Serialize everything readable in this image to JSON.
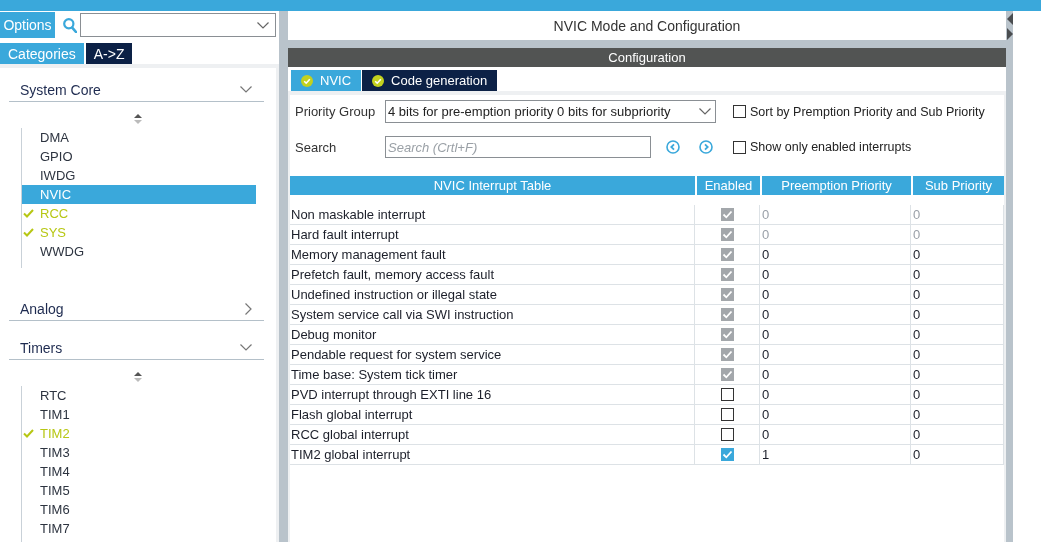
{
  "sidebar": {
    "options_label": "Options",
    "view_tabs": [
      {
        "label": "Categories",
        "selected": true
      },
      {
        "label": "A->Z",
        "selected": false
      }
    ],
    "sections": [
      {
        "title": "System Core",
        "expanded": true,
        "items": [
          {
            "label": "DMA",
            "selected": false,
            "configured": false
          },
          {
            "label": "GPIO",
            "selected": false,
            "configured": false
          },
          {
            "label": "IWDG",
            "selected": false,
            "configured": false
          },
          {
            "label": "NVIC",
            "selected": true,
            "configured": false
          },
          {
            "label": "RCC",
            "selected": false,
            "configured": true
          },
          {
            "label": "SYS",
            "selected": false,
            "configured": true
          },
          {
            "label": "WWDG",
            "selected": false,
            "configured": false
          }
        ]
      },
      {
        "title": "Analog",
        "expanded": false
      },
      {
        "title": "Timers",
        "expanded": true,
        "items": [
          {
            "label": "RTC",
            "selected": false,
            "configured": false
          },
          {
            "label": "TIM1",
            "selected": false,
            "configured": false
          },
          {
            "label": "TIM2",
            "selected": false,
            "configured": true
          },
          {
            "label": "TIM3",
            "selected": false,
            "configured": false
          },
          {
            "label": "TIM4",
            "selected": false,
            "configured": false
          },
          {
            "label": "TIM5",
            "selected": false,
            "configured": false
          },
          {
            "label": "TIM6",
            "selected": false,
            "configured": false
          },
          {
            "label": "TIM7",
            "selected": false,
            "configured": false
          }
        ]
      }
    ]
  },
  "main": {
    "title": "NVIC Mode and Configuration",
    "configuration_title": "Configuration",
    "tabs": [
      {
        "label": "NVIC",
        "selected": true
      },
      {
        "label": "Code generation",
        "selected": false
      }
    ],
    "priority_group": {
      "label": "Priority Group",
      "value": "4 bits for pre-emption priority 0 bits for subpriority"
    },
    "search": {
      "label": "Search",
      "placeholder": "Search (Crtl+F)"
    },
    "options": [
      {
        "label": "Sort by Premption Priority and Sub Priority",
        "checked": false
      },
      {
        "label": "Show only enabled interrupts",
        "checked": false
      }
    ],
    "table": {
      "columns": [
        "NVIC Interrupt Table",
        "Enabled",
        "Preemption Priority",
        "Sub Priority"
      ],
      "rows": [
        {
          "name": "Non maskable interrupt",
          "enabled": true,
          "disabled": true,
          "preemption_priority": "0",
          "sub_priority": "0",
          "priorities_disabled": true
        },
        {
          "name": "Hard fault interrupt",
          "enabled": true,
          "disabled": true,
          "preemption_priority": "0",
          "sub_priority": "0",
          "priorities_disabled": true
        },
        {
          "name": "Memory management fault",
          "enabled": true,
          "disabled": true,
          "preemption_priority": "0",
          "sub_priority": "0",
          "priorities_disabled": false
        },
        {
          "name": "Prefetch fault, memory access fault",
          "enabled": true,
          "disabled": true,
          "preemption_priority": "0",
          "sub_priority": "0",
          "priorities_disabled": false
        },
        {
          "name": "Undefined instruction or illegal state",
          "enabled": true,
          "disabled": true,
          "preemption_priority": "0",
          "sub_priority": "0",
          "priorities_disabled": false
        },
        {
          "name": "System service call via SWI instruction",
          "enabled": true,
          "disabled": true,
          "preemption_priority": "0",
          "sub_priority": "0",
          "priorities_disabled": false
        },
        {
          "name": "Debug monitor",
          "enabled": true,
          "disabled": true,
          "preemption_priority": "0",
          "sub_priority": "0",
          "priorities_disabled": false
        },
        {
          "name": "Pendable request for system service",
          "enabled": true,
          "disabled": true,
          "preemption_priority": "0",
          "sub_priority": "0",
          "priorities_disabled": false
        },
        {
          "name": "Time base: System tick timer",
          "enabled": true,
          "disabled": true,
          "preemption_priority": "0",
          "sub_priority": "0",
          "priorities_disabled": false
        },
        {
          "name": "PVD interrupt through EXTI line 16",
          "enabled": false,
          "disabled": false,
          "preemption_priority": "0",
          "sub_priority": "0",
          "priorities_disabled": false
        },
        {
          "name": "Flash global interrupt",
          "enabled": false,
          "disabled": false,
          "preemption_priority": "0",
          "sub_priority": "0",
          "priorities_disabled": false
        },
        {
          "name": "RCC global interrupt",
          "enabled": false,
          "disabled": false,
          "preemption_priority": "0",
          "sub_priority": "0",
          "priorities_disabled": false
        },
        {
          "name": "TIM2 global interrupt",
          "enabled": true,
          "disabled": false,
          "preemption_priority": "1",
          "sub_priority": "0",
          "priorities_disabled": false
        }
      ]
    }
  }
}
